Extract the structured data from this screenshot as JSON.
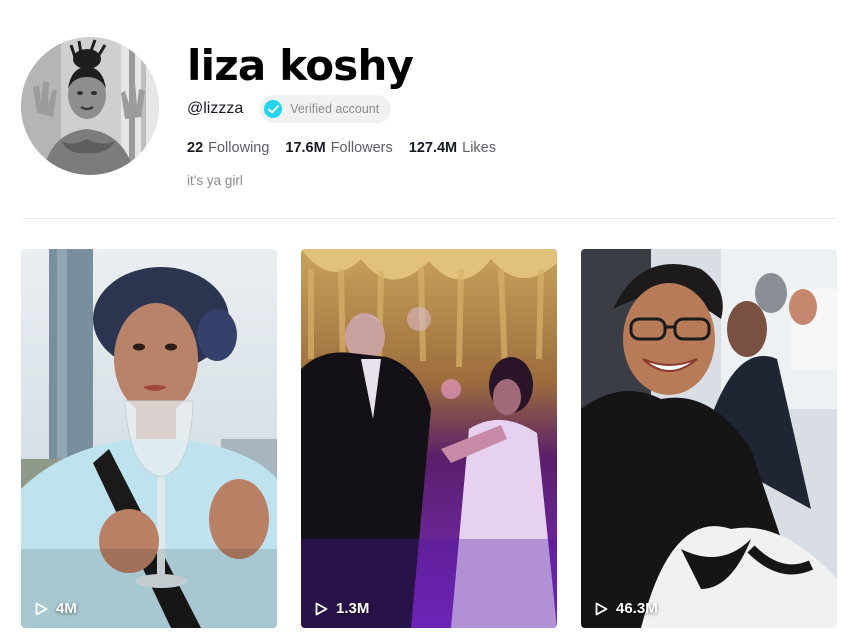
{
  "profile": {
    "display_name": "liza koshy",
    "username": "@lizzza",
    "verified_label": "Verified account",
    "bio": "it's ya girl",
    "stats": {
      "following_value": "22",
      "following_label": "Following",
      "followers_value": "17.6M",
      "followers_label": "Followers",
      "likes_value": "127.4M",
      "likes_label": "Likes"
    }
  },
  "videos": [
    {
      "views": "4M"
    },
    {
      "views": "1.3M"
    },
    {
      "views": "46.3M"
    }
  ],
  "colors": {
    "verified_accent": "#20d5ec",
    "text_primary": "#161823",
    "text_secondary": "#8a8b91"
  },
  "icons": {
    "verified": "check-circle",
    "views": "play-outline"
  }
}
